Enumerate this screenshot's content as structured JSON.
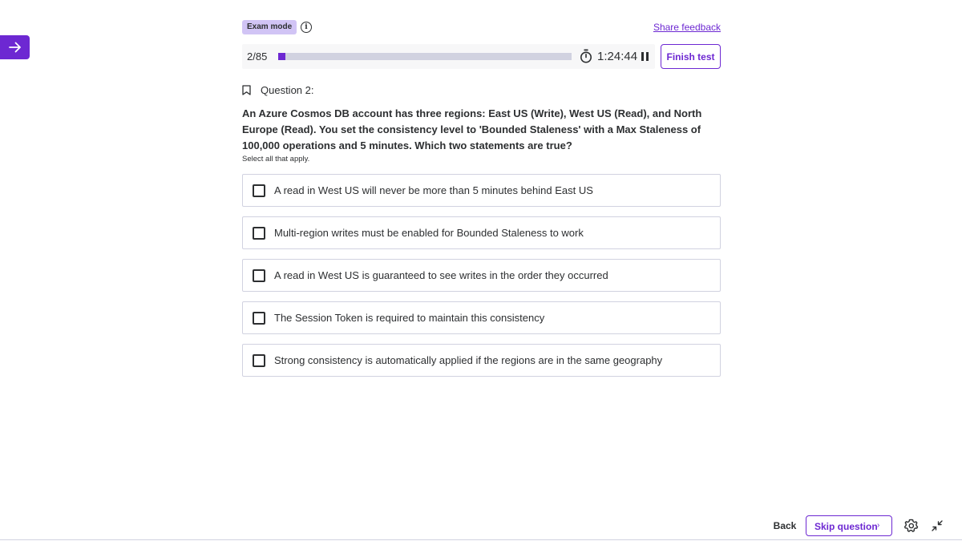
{
  "exam": {
    "mode_label": "Exam mode",
    "share_feedback": "Share feedback",
    "progress_text": "2/85",
    "progress_fraction": 0.0235,
    "timer": "1:24:44",
    "finish_label": "Finish test"
  },
  "question": {
    "label": "Question 2:",
    "text": "An Azure Cosmos DB account has three regions: East US (Write), West US (Read), and North Europe (Read). You set the consistency level to 'Bounded Staleness' with a Max Staleness of 100,000 operations and 5 minutes. Which two statements are true?",
    "hint": "Select all that apply.",
    "options": [
      {
        "label": "A read in West US will never be more than 5 minutes behind East US",
        "checked": false
      },
      {
        "label": "Multi-region writes must be enabled for Bounded Staleness to work",
        "checked": false
      },
      {
        "label": "A read in West US is guaranteed to see writes in the order they occurred",
        "checked": false
      },
      {
        "label": "The Session Token is required to maintain this consistency",
        "checked": false
      },
      {
        "label": "Strong consistency is automatically applied if the regions are in the same geography",
        "checked": false
      }
    ]
  },
  "footer": {
    "back_label": "Back",
    "skip_label": "Skip question",
    "skip_chevron": "›"
  },
  "icons": {
    "sidebar": "arrow-right-icon",
    "info": "info-icon",
    "timer": "stopwatch-icon",
    "pause": "pause-icon",
    "bookmark": "bookmark-icon",
    "settings": "gear-icon",
    "collapse": "collapse-icon"
  },
  "colors": {
    "accent": "#6d28d2",
    "badge": "#d1c4f5",
    "track": "#d1d2e0",
    "text": "#2d2f31",
    "border": "#d1d2e0"
  }
}
